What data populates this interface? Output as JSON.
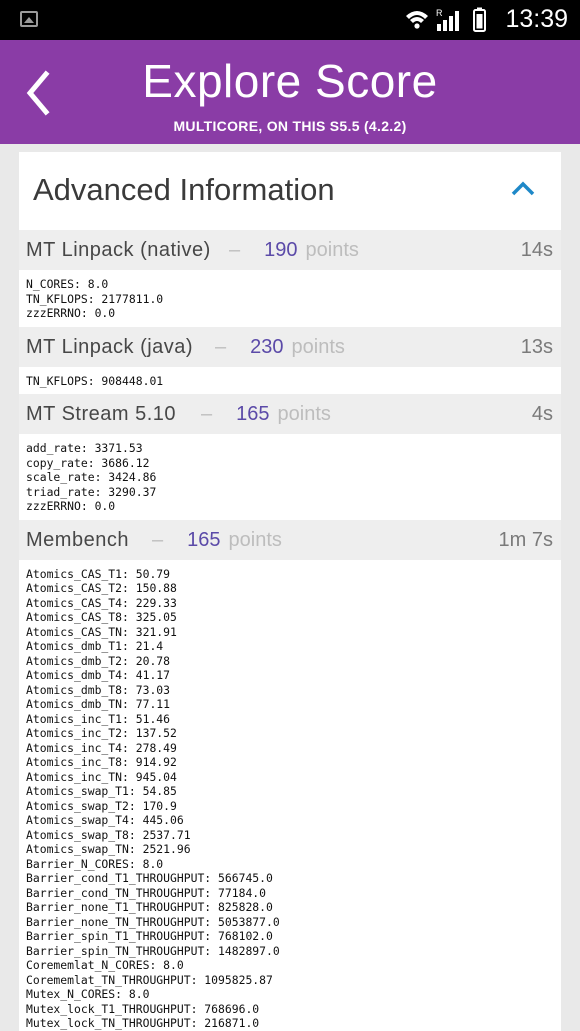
{
  "status_bar": {
    "time": "13:39",
    "icons": [
      "gallery-icon",
      "wifi-icon",
      "signal-icon",
      "battery-icon"
    ],
    "roaming_label": "R"
  },
  "app_bar": {
    "title": "Explore Score",
    "subtitle": "MULTICORE, ON THIS S5.5 (4.2.2)",
    "back_icon": "chevron-left-icon",
    "color": "#8a3ca6"
  },
  "card": {
    "title": "Advanced Information",
    "collapse_icon": "chevron-up-icon",
    "accent": "#1e88c8"
  },
  "sections": [
    {
      "name": "MT Linpack (native)",
      "dash": "–",
      "points": "190",
      "unit": "points",
      "duration": "14s",
      "lines": [
        "N_CORES: 8.0",
        "TN_KFLOPS: 2177811.0",
        "zzzERRNO: 0.0"
      ]
    },
    {
      "name": "MT Linpack (java)",
      "dash": "–",
      "points": "230",
      "unit": "points",
      "duration": "13s",
      "lines": [
        "TN_KFLOPS: 908448.01"
      ]
    },
    {
      "name": "MT Stream 5.10",
      "dash": "–",
      "points": "165",
      "unit": "points",
      "duration": "4s",
      "lines": [
        "add_rate: 3371.53",
        "copy_rate: 3686.12",
        "scale_rate: 3424.86",
        "triad_rate: 3290.37",
        "zzzERRNO: 0.0"
      ]
    },
    {
      "name": "Membench",
      "dash": "–",
      "points": "165",
      "unit": "points",
      "duration": "1m 7s",
      "lines": [
        "Atomics_CAS_T1: 50.79",
        "Atomics_CAS_T2: 150.88",
        "Atomics_CAS_T4: 229.33",
        "Atomics_CAS_T8: 325.05",
        "Atomics_CAS_TN: 321.91",
        "Atomics_dmb_T1: 21.4",
        "Atomics_dmb_T2: 20.78",
        "Atomics_dmb_T4: 41.17",
        "Atomics_dmb_T8: 73.03",
        "Atomics_dmb_TN: 77.11",
        "Atomics_inc_T1: 51.46",
        "Atomics_inc_T2: 137.52",
        "Atomics_inc_T4: 278.49",
        "Atomics_inc_T8: 914.92",
        "Atomics_inc_TN: 945.04",
        "Atomics_swap_T1: 54.85",
        "Atomics_swap_T2: 170.9",
        "Atomics_swap_T4: 445.06",
        "Atomics_swap_T8: 2537.71",
        "Atomics_swap_TN: 2521.96",
        "Barrier_N_CORES: 8.0",
        "Barrier_cond_T1_THROUGHPUT: 566745.0",
        "Barrier_cond_TN_THROUGHPUT: 77184.0",
        "Barrier_none_T1_THROUGHPUT: 825828.0",
        "Barrier_none_TN_THROUGHPUT: 5053877.0",
        "Barrier_spin_T1_THROUGHPUT: 768102.0",
        "Barrier_spin_TN_THROUGHPUT: 1482897.0",
        "Corememlat_N_CORES: 8.0",
        "Corememlat_TN_THROUGHPUT: 1095825.87",
        "Mutex_N_CORES: 8.0",
        "Mutex_lock_T1_THROUGHPUT: 768696.0",
        "Mutex_lock_TN_THROUGHPUT: 216871.0"
      ]
    }
  ]
}
